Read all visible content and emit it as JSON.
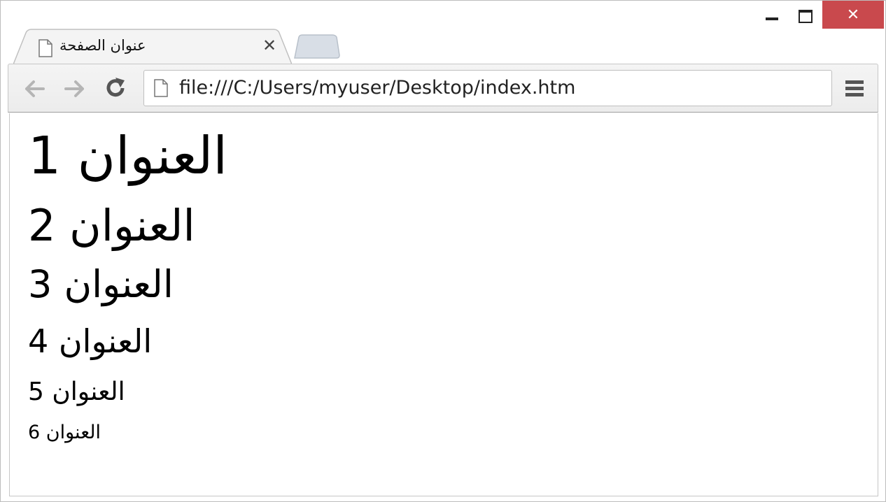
{
  "tab": {
    "title": "عنوان الصفحة"
  },
  "address_bar": {
    "url": "file:///C:/Users/myuser/Desktop/index.htm"
  },
  "headings": [
    "العنوان 1",
    "العنوان 2",
    "العنوان 3",
    "العنوان 4",
    "العنوان 5",
    "العنوان 6"
  ],
  "icons": {
    "back": "back-arrow-icon",
    "forward": "forward-arrow-icon",
    "reload": "reload-icon",
    "page": "page-icon",
    "menu": "hamburger-menu-icon",
    "tab_close": "close-icon"
  },
  "colors": {
    "close_button": "#c9494d",
    "toolbar": "#f2f2f2"
  }
}
